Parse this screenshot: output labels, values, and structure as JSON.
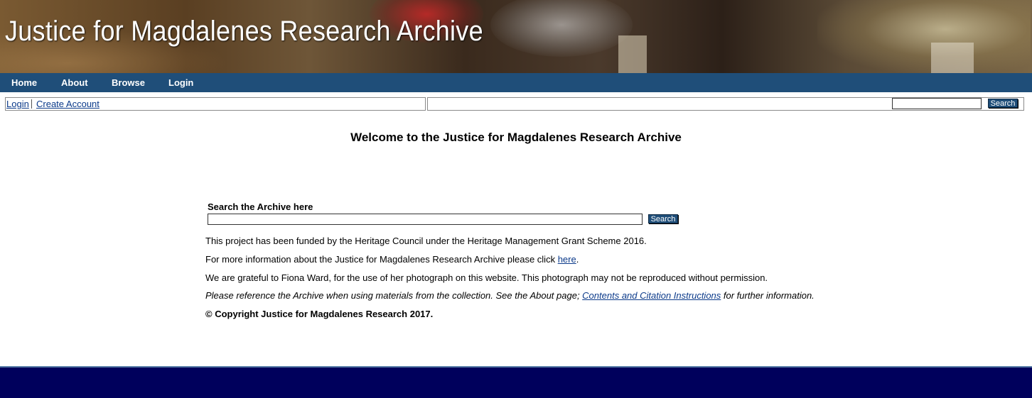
{
  "banner": {
    "title": "Justice for Magdalenes Research Archive"
  },
  "nav": {
    "items": [
      "Home",
      "About",
      "Browse",
      "Login"
    ]
  },
  "utility": {
    "login": "Login",
    "create_account": "Create Account",
    "search_button": "Search",
    "search_value": ""
  },
  "main": {
    "welcome": "Welcome to the Justice for Magdalenes Research Archive",
    "search_label": "Search the Archive here",
    "search_button": "Search",
    "search_value": "",
    "funding": "This project has been funded by the Heritage Council under the Heritage Management Grant Scheme 2016.",
    "info_prefix": "For more information about the Justice for Magdalenes Research Archive please click ",
    "info_link": "here",
    "info_suffix": ".",
    "grateful": "We are grateful to Fiona Ward, for the use of her photograph on this website. This photograph may not be reproduced without permission.",
    "reference_prefix": "Please reference the Archive when using materials from the collection. See the About page; ",
    "reference_link": "Contents and Citation Instructions",
    "reference_suffix": " for further information.",
    "copyright": "© Copyright Justice for Magdalenes Research 2017."
  },
  "colors": {
    "nav_bg": "#1f4e79",
    "footer_bg": "#00005c",
    "link": "#0b3a8a"
  }
}
